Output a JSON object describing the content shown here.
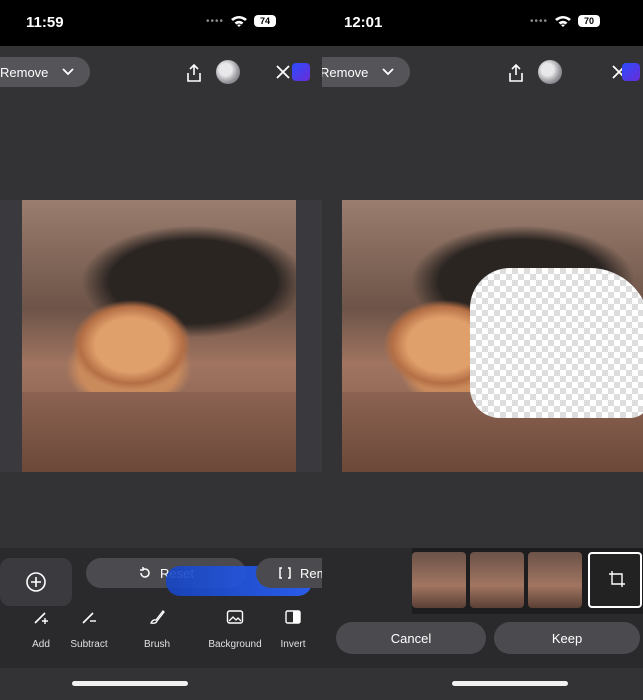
{
  "left": {
    "status": {
      "time": "11:59",
      "battery": "74"
    },
    "topbar": {
      "mode_label": "Remove"
    },
    "controls": {
      "reset_label": "Reset",
      "remove_label": "Remove"
    },
    "tools": [
      {
        "label": "Add",
        "icon": "add-brush-icon"
      },
      {
        "label": "Subtract",
        "icon": "subtract-brush-icon"
      },
      {
        "label": "Brush",
        "icon": "brush-icon"
      },
      {
        "label": "Background",
        "icon": "background-icon"
      },
      {
        "label": "Invert",
        "icon": "invert-icon"
      }
    ]
  },
  "right": {
    "status": {
      "time": "12:01",
      "battery": "70"
    },
    "topbar": {
      "mode_label": "Remove"
    },
    "actions": {
      "cancel_label": "Cancel",
      "keep_label": "Keep"
    }
  },
  "colors": {
    "panel": "#333336",
    "pill": "#4b4b4f",
    "accent": "#2a62ff"
  }
}
